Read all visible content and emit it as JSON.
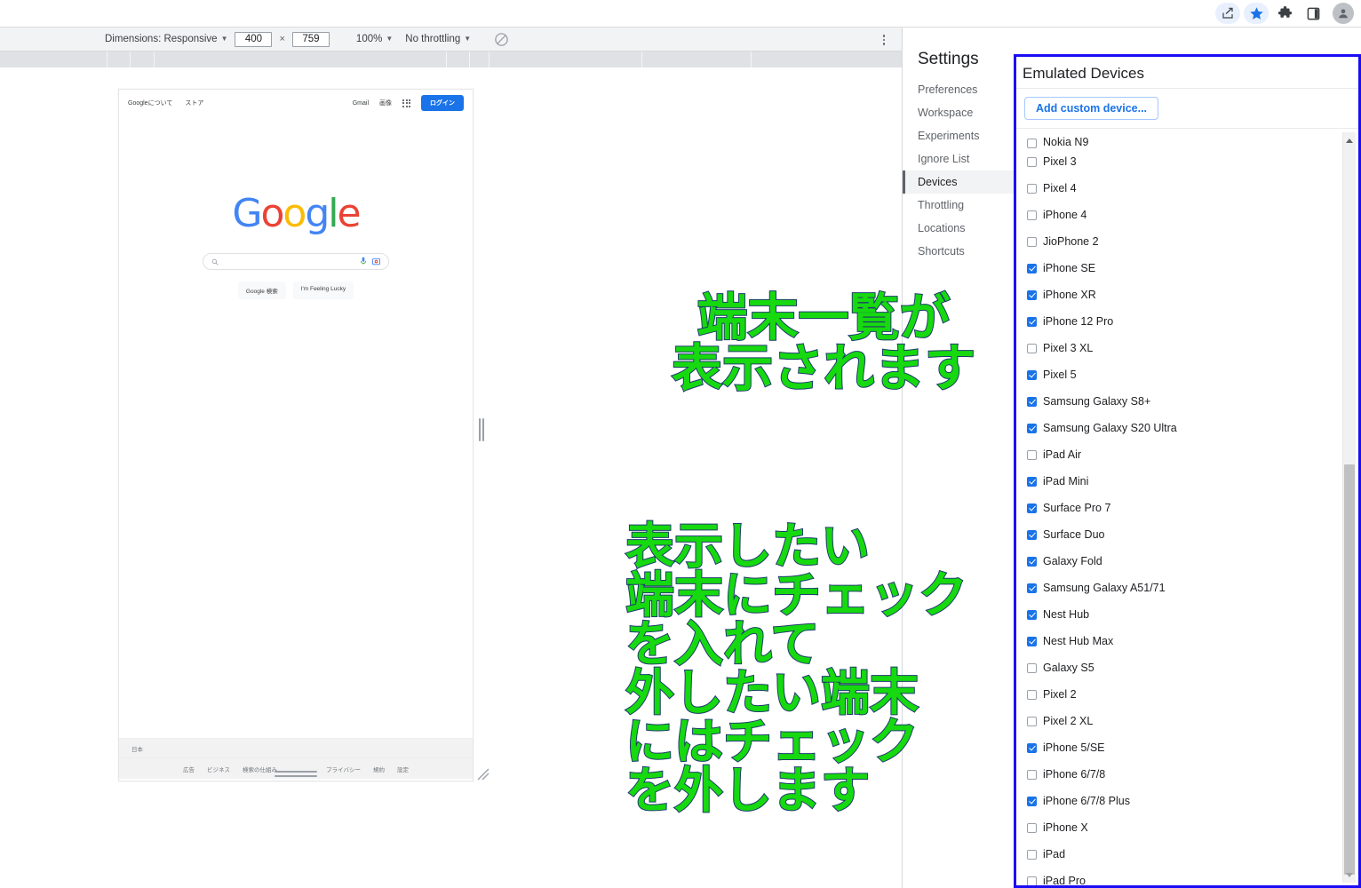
{
  "browser": {
    "icons": [
      "share-icon",
      "bookmark-star-icon",
      "extensions-puzzle-icon",
      "side-panel-icon",
      "profile-avatar-icon"
    ]
  },
  "device_toolbar": {
    "dimensions_label": "Dimensions: Responsive",
    "width_value": "400",
    "height_value": "759",
    "times": "×",
    "zoom": "100%",
    "throttling": "No throttling",
    "rotate_icon": "rotate-disabled-icon",
    "kebab": "more-options-icon"
  },
  "viewport": {
    "google": {
      "header_left": [
        "Googleについて",
        "ストア"
      ],
      "header_right": [
        "Gmail",
        "画像"
      ],
      "apps_icon": "google-apps-grid-icon",
      "signin": "ログイン",
      "logo": "Google",
      "search_placeholder": "",
      "mic_icon": "microphone-icon",
      "lens_icon": "google-lens-icon",
      "buttons": [
        "Google 検索",
        "I'm Feeling Lucky"
      ],
      "country": "日本",
      "footer_left": [
        "広告",
        "ビジネス",
        "検索の仕組み"
      ],
      "footer_right": [
        "プライバシー",
        "規約",
        "設定"
      ]
    }
  },
  "settings": {
    "title": "Settings",
    "nav_items": [
      {
        "label": "Preferences",
        "active": false
      },
      {
        "label": "Workspace",
        "active": false
      },
      {
        "label": "Experiments",
        "active": false
      },
      {
        "label": "Ignore List",
        "active": false
      },
      {
        "label": "Devices",
        "active": true
      },
      {
        "label": "Throttling",
        "active": false
      },
      {
        "label": "Locations",
        "active": false
      },
      {
        "label": "Shortcuts",
        "active": false
      }
    ]
  },
  "devices_panel": {
    "header": "Emulated Devices",
    "add_button": "Add custom device...",
    "highlight_color": "#1a0cf5",
    "accent_color": "#1a73e8",
    "devices": [
      {
        "label": "Nokia N9",
        "checked": false
      },
      {
        "label": "Pixel 3",
        "checked": false
      },
      {
        "label": "Pixel 4",
        "checked": false
      },
      {
        "label": "iPhone 4",
        "checked": false
      },
      {
        "label": "JioPhone 2",
        "checked": false
      },
      {
        "label": "iPhone SE",
        "checked": true
      },
      {
        "label": "iPhone XR",
        "checked": true
      },
      {
        "label": "iPhone 12 Pro",
        "checked": true
      },
      {
        "label": "Pixel 3 XL",
        "checked": false
      },
      {
        "label": "Pixel 5",
        "checked": true
      },
      {
        "label": "Samsung Galaxy S8+",
        "checked": true
      },
      {
        "label": "Samsung Galaxy S20 Ultra",
        "checked": true
      },
      {
        "label": "iPad Air",
        "checked": false
      },
      {
        "label": "iPad Mini",
        "checked": true
      },
      {
        "label": "Surface Pro 7",
        "checked": true
      },
      {
        "label": "Surface Duo",
        "checked": true
      },
      {
        "label": "Galaxy Fold",
        "checked": true
      },
      {
        "label": "Samsung Galaxy A51/71",
        "checked": true
      },
      {
        "label": "Nest Hub",
        "checked": true
      },
      {
        "label": "Nest Hub Max",
        "checked": true
      },
      {
        "label": "Galaxy S5",
        "checked": false
      },
      {
        "label": "Pixel 2",
        "checked": false
      },
      {
        "label": "Pixel 2 XL",
        "checked": false
      },
      {
        "label": "iPhone 5/SE",
        "checked": true
      },
      {
        "label": "iPhone 6/7/8",
        "checked": false
      },
      {
        "label": "iPhone 6/7/8 Plus",
        "checked": true
      },
      {
        "label": "iPhone X",
        "checked": false
      },
      {
        "label": "iPad",
        "checked": false
      },
      {
        "label": "iPad Pro",
        "checked": false
      }
    ]
  },
  "annotations": {
    "text_color": "#16d90f",
    "outline_color": "#1f3a6e",
    "note_1": "端末一覧が\n表示されます",
    "note_2": "表示したい\n端末にチェック\nを入れて\n外したい端末\nにはチェック\nを外します"
  }
}
